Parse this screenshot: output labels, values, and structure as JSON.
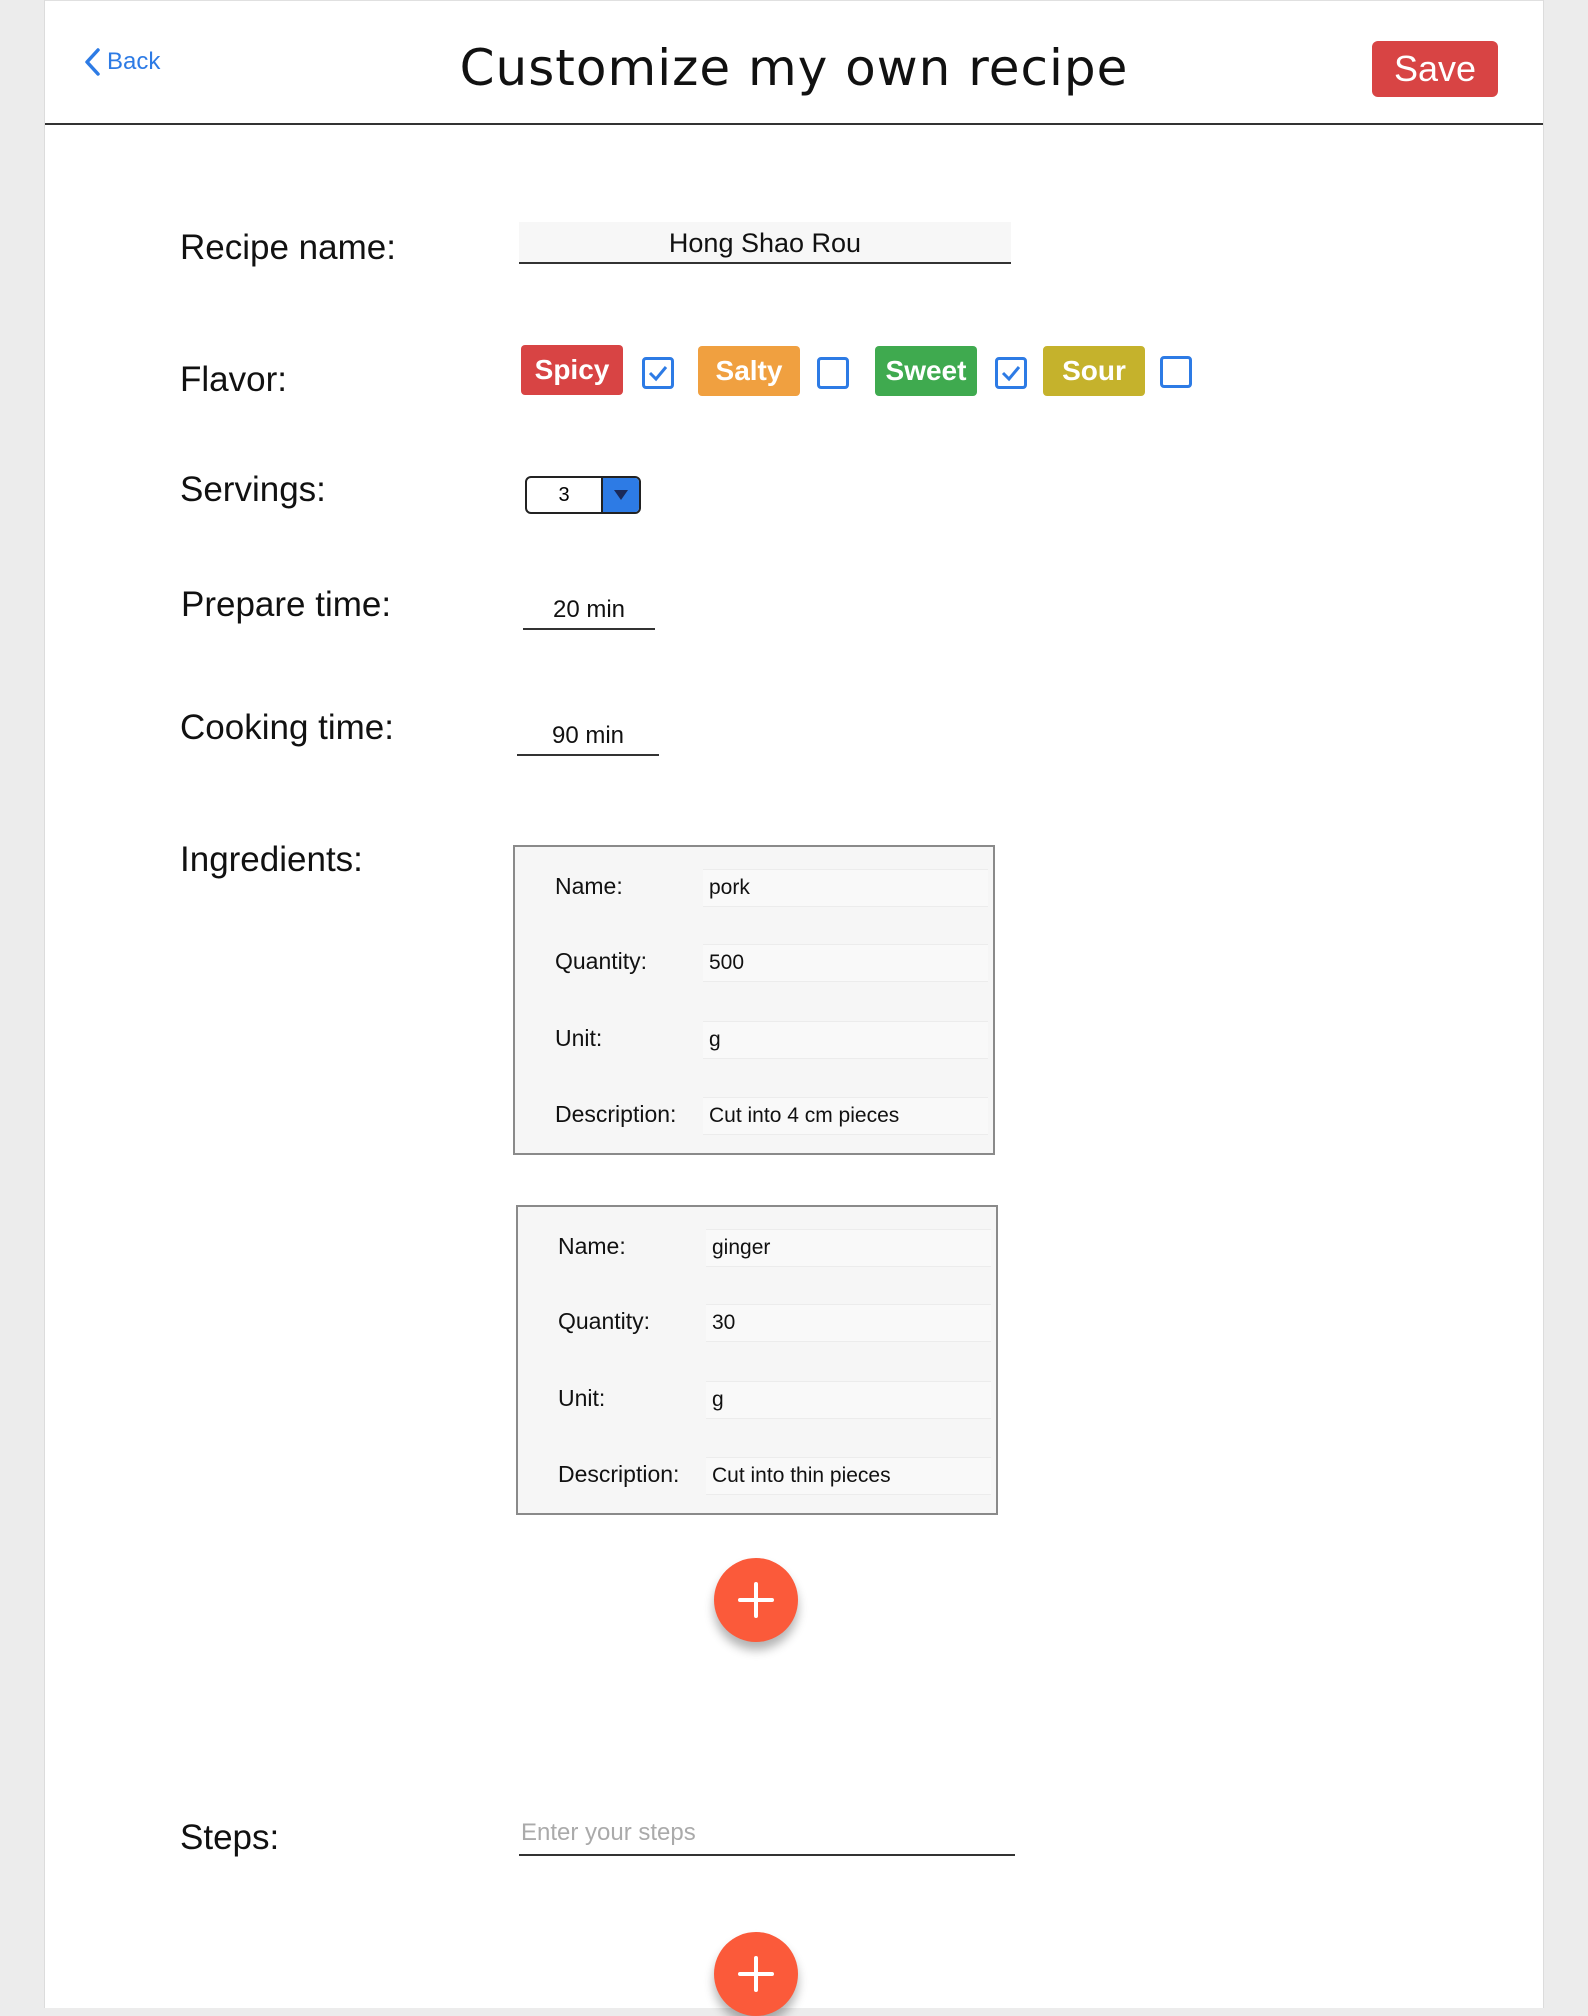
{
  "header": {
    "back_label": "Back",
    "title": "Customize my own recipe",
    "save_label": "Save"
  },
  "form": {
    "recipe_name_label": "Recipe name:",
    "recipe_name_value": "Hong Shao Rou",
    "flavor_label": "Flavor:",
    "flavors": [
      {
        "label": "Spicy",
        "color": "#d84444",
        "checked": true
      },
      {
        "label": "Salty",
        "color": "#f0a040",
        "checked": false
      },
      {
        "label": "Sweet",
        "color": "#3faa4f",
        "checked": true
      },
      {
        "label": "Sour",
        "color": "#c5b22c",
        "checked": false
      }
    ],
    "servings_label": "Servings:",
    "servings_value": "3",
    "prepare_label": "Prepare time:",
    "prepare_value": "20 min",
    "cooking_label": "Cooking time:",
    "cooking_value": "90 min",
    "ingredients_label": "Ingredients:",
    "ingredient_field_labels": {
      "name": "Name:",
      "quantity": "Quantity:",
      "unit": "Unit:",
      "description": "Description:"
    },
    "ingredients": [
      {
        "name": "pork",
        "quantity": "500",
        "unit": "g",
        "description": "Cut into 4 cm pieces"
      },
      {
        "name": "ginger",
        "quantity": "30",
        "unit": "g",
        "description": "Cut into thin pieces"
      }
    ],
    "steps_label": "Steps:",
    "steps_placeholder": "Enter your steps"
  },
  "icons": {
    "back": "chevron-left-icon",
    "dropdown": "caret-down-icon",
    "add": "plus-icon",
    "check": "checkmark-icon"
  }
}
